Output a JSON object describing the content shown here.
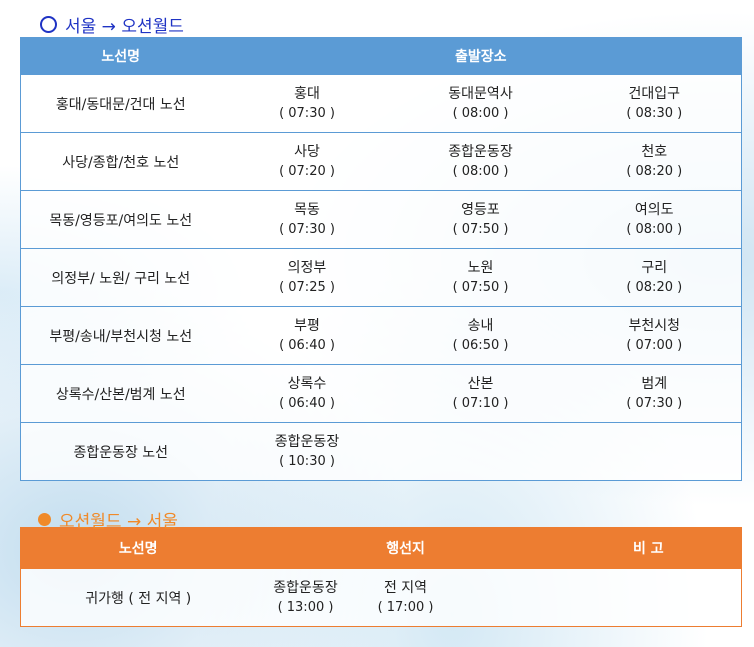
{
  "section1": {
    "title": "서울 → 오션월드",
    "headers": [
      "노선명",
      "출발장소"
    ],
    "routes": [
      {
        "name": "홍대/동대문/건대 노선",
        "stops": [
          {
            "place": "홍대",
            "time": "( 07:30 )"
          },
          {
            "place": "동대문역사",
            "time": "( 08:00 )"
          },
          {
            "place": "건대입구",
            "time": "( 08:30 )"
          }
        ]
      },
      {
        "name": "사당/종합/천호 노선",
        "stops": [
          {
            "place": "사당",
            "time": "( 07:20 )"
          },
          {
            "place": "종합운동장",
            "time": "( 08:00 )"
          },
          {
            "place": "천호",
            "time": "( 08:20 )"
          }
        ]
      },
      {
        "name": "목동/영등포/여의도 노선",
        "stops": [
          {
            "place": "목동",
            "time": "( 07:30 )"
          },
          {
            "place": "영등포",
            "time": "( 07:50 )"
          },
          {
            "place": "여의도",
            "time": "( 08:00 )"
          }
        ]
      },
      {
        "name": "의정부/ 노원/ 구리 노선",
        "stops": [
          {
            "place": "의정부",
            "time": "( 07:25 )"
          },
          {
            "place": "노원",
            "time": "( 07:50 )"
          },
          {
            "place": "구리",
            "time": "( 08:20 )"
          }
        ]
      },
      {
        "name": "부평/송내/부천시청 노선",
        "stops": [
          {
            "place": "부평",
            "time": "( 06:40 )"
          },
          {
            "place": "송내",
            "time": "( 06:50 )"
          },
          {
            "place": "부천시청",
            "time": "( 07:00 )"
          }
        ]
      },
      {
        "name": "상록수/산본/범계 노선",
        "stops": [
          {
            "place": "상록수",
            "time": "( 06:40 )"
          },
          {
            "place": "산본",
            "time": "( 07:10 )"
          },
          {
            "place": "범계",
            "time": "( 07:30 )"
          }
        ]
      },
      {
        "name": "종합운동장 노선",
        "stops": [
          {
            "place": "종합운동장",
            "time": "( 10:30 )"
          }
        ]
      }
    ]
  },
  "section2": {
    "title": "오션월드 → 서울",
    "headers": [
      "노선명",
      "행선지",
      "비 고"
    ],
    "rows": [
      {
        "name": "귀가행 ( 전 지역 )",
        "stops": [
          {
            "place": "종합운동장",
            "time": "( 13:00 )"
          },
          {
            "place": "전 지역",
            "time": "( 17:00 )"
          }
        ],
        "note": ""
      }
    ]
  },
  "colors": {
    "blue_title": "#1f33c4",
    "blue_header": "#5b9bd5",
    "orange": "#ed7d31"
  },
  "icons": {
    "section1": "circle-outline-icon",
    "section2": "circle-filled-icon"
  }
}
